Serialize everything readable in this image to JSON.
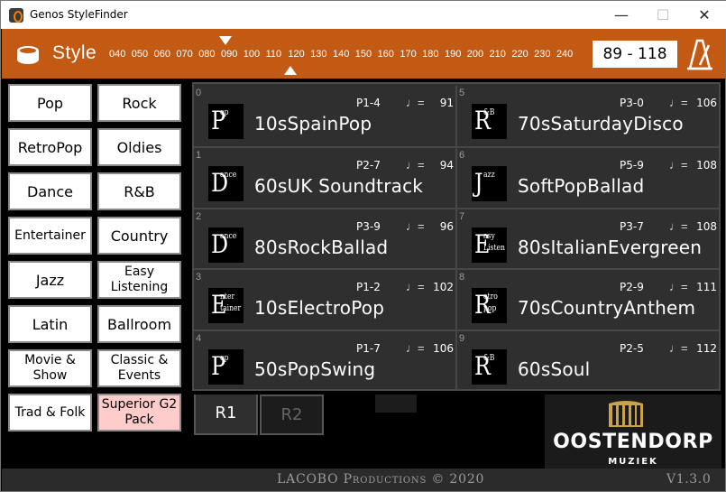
{
  "window": {
    "title": "Genos StyleFinder",
    "minimize": "—",
    "maximize": "☐",
    "close": "✕"
  },
  "header": {
    "style_label": "Style",
    "tempo_marks": [
      "040",
      "050",
      "060",
      "070",
      "080",
      "090",
      "100",
      "110",
      "120",
      "130",
      "140",
      "150",
      "160",
      "170",
      "180",
      "190",
      "200",
      "210",
      "220",
      "230",
      "240"
    ],
    "tempo_range": "89 - 118",
    "icons": [
      "drum-icon",
      "metronome-icon"
    ]
  },
  "categories": [
    {
      "label": "Pop"
    },
    {
      "label": "Rock"
    },
    {
      "label": "RetroPop"
    },
    {
      "label": "Oldies"
    },
    {
      "label": "Dance"
    },
    {
      "label": "R&B"
    },
    {
      "label": "Entertainer"
    },
    {
      "label": "Country"
    },
    {
      "label": "Jazz"
    },
    {
      "label": "Easy Listening"
    },
    {
      "label": "Latin"
    },
    {
      "label": "Ballroom"
    },
    {
      "label": "Movie & Show"
    },
    {
      "label": "Classic & Events"
    },
    {
      "label": "Trad & Folk"
    },
    {
      "label": "Superior G2 Pack"
    }
  ],
  "styles": [
    {
      "index": "0",
      "logo_big": "P",
      "logo_sup": "op",
      "logo_sup2": "",
      "name": "10sSpainPop",
      "reg": "P1-4",
      "note": "♩=",
      "tempo": "91"
    },
    {
      "index": "1",
      "logo_big": "D",
      "logo_sup": "ance",
      "logo_sup2": "",
      "name": "60sUK Soundtrack",
      "reg": "P2-7",
      "note": "♩=",
      "tempo": "94"
    },
    {
      "index": "2",
      "logo_big": "D",
      "logo_sup": "ance",
      "logo_sup2": "",
      "name": "80sRockBallad",
      "reg": "P3-9",
      "note": "♩=",
      "tempo": "96"
    },
    {
      "index": "3",
      "logo_big": "E",
      "logo_sup": "nter",
      "logo_sup2": "tainer",
      "name": "10sElectroPop",
      "reg": "P1-2",
      "note": "♩=",
      "tempo": "102"
    },
    {
      "index": "4",
      "logo_big": "P",
      "logo_sup": "op",
      "logo_sup2": "",
      "name": "50sPopSwing",
      "reg": "P1-7",
      "note": "♩=",
      "tempo": "106"
    },
    {
      "index": "5",
      "logo_big": "R",
      "logo_sup": "&B",
      "logo_sup2": "",
      "name": "70sSaturdayDisco",
      "reg": "P3-0",
      "note": "♩=",
      "tempo": "106"
    },
    {
      "index": "6",
      "logo_big": "J",
      "logo_sup": "azz",
      "logo_sup2": "",
      "name": "SoftPopBallad",
      "reg": "P5-9",
      "note": "♩=",
      "tempo": "108"
    },
    {
      "index": "7",
      "logo_big": "E",
      "logo_sup": "asy",
      "logo_sup2": "Listen",
      "name": "80sItalianEvergreen",
      "reg": "P3-7",
      "note": "♩=",
      "tempo": "108"
    },
    {
      "index": "8",
      "logo_big": "R",
      "logo_sup": "etro",
      "logo_sup2": "pop",
      "name": "70sCountryAnthem",
      "reg": "P2-9",
      "note": "♩=",
      "tempo": "111"
    },
    {
      "index": "9",
      "logo_big": "R",
      "logo_sup": "&B",
      "logo_sup2": "",
      "name": "60sSoul",
      "reg": "P2-5",
      "note": "♩=",
      "tempo": "112"
    }
  ],
  "tabs": [
    {
      "label": "R1",
      "active": true
    },
    {
      "label": "R2",
      "active": false
    }
  ],
  "brand": {
    "name": "OOSTENDORP",
    "sub": "MUZIEK"
  },
  "footer": {
    "credit": "LACOBO Productions © 2020",
    "version": "V1.3.0"
  },
  "colors": {
    "header_orange": "#c25a14",
    "panel_bg": "#2f2f2f",
    "selected_category": "#ffcccc"
  }
}
